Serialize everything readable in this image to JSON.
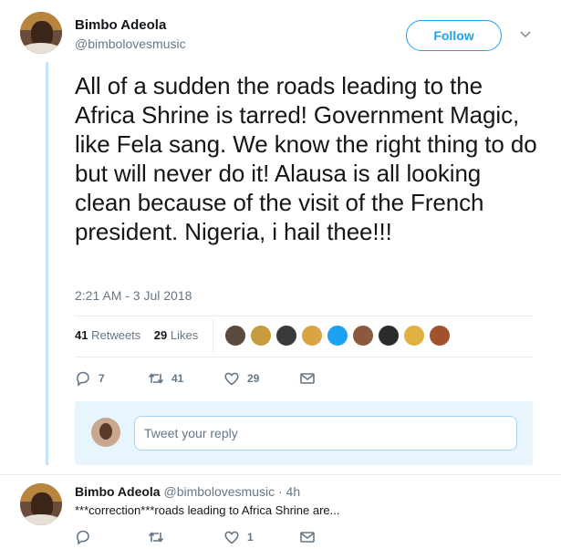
{
  "tweet": {
    "author_name": "Bimbo Adeola",
    "author_handle": "@bimbolovesmusic",
    "follow_label": "Follow",
    "text": "All of a sudden the roads leading to the Africa Shrine is tarred! Government Magic, like Fela sang. We know the right thing to do but will never do it! Alausa is all looking clean because of the visit of the French president. Nigeria, i hail thee!!!",
    "timestamp": "2:21 AM - 3 Jul 2018",
    "retweets_count": "41",
    "retweets_label": "Retweets",
    "likes_count": "29",
    "likes_label": "Likes",
    "liker_colors": [
      "#5b4a3d",
      "#c89b3c",
      "#3a3a3a",
      "#d9a441",
      "#1da1f2",
      "#8b5a3c",
      "#2b2b2b",
      "#e0b040",
      "#a0522d"
    ],
    "actions": {
      "reply_count": "7",
      "retweet_count": "41",
      "like_count": "29"
    }
  },
  "reply_composer": {
    "placeholder": "Tweet your reply"
  },
  "reply": {
    "author_name": "Bimbo Adeola",
    "author_handle": "@bimbolovesmusic",
    "time": "· 4h",
    "text": "***correction***roads leading to Africa Shrine are...",
    "like_count": "1"
  },
  "icons": {
    "reply": "speech-bubble-icon",
    "retweet": "retweet-icon",
    "like": "heart-icon",
    "message": "envelope-icon",
    "caret": "chevron-down-icon"
  },
  "colors": {
    "accent": "#1da1f2",
    "thread_line": "#c4e3fa",
    "secondary_text": "#657786"
  }
}
